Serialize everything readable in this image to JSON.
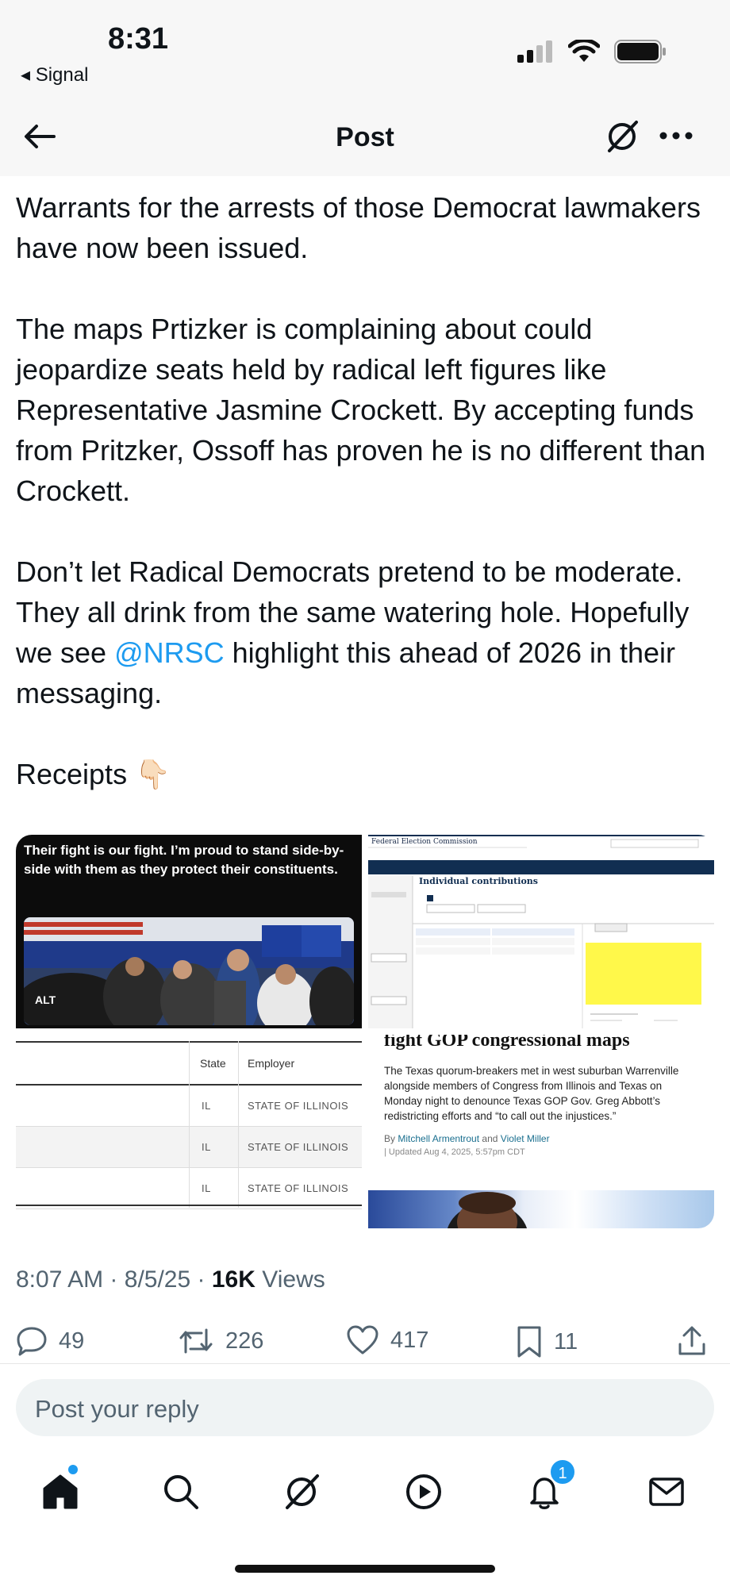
{
  "status_bar": {
    "time": "8:31",
    "back_app": "◂ Signal"
  },
  "header": {
    "title": "Post",
    "icons": {
      "back": "back-arrow-icon",
      "grok": "grok-icon",
      "more": "more-icon"
    }
  },
  "post": {
    "paragraphs": [
      "Warrants for the arrests of those Democrat lawmakers have now been issued.",
      "The maps Prtizker is complaining about could jeopardize seats held by radical left figures like Representative Jasmine Crockett. By accepting funds from Pritzker, Ossoff has proven he is no different than Crockett.",
      "Receipts 👇🏻"
    ],
    "para3_before": "Don’t let Radical Democrats pretend to be moderate. They all drink from the same watering hole. Hopefully we see ",
    "mention": "@NRSC",
    "para3_after": " highlight this ahead of 2026 in their messaging."
  },
  "media": {
    "tile1": {
      "quote": "Their fight is our fight. I’m proud to stand side-by-side with them as they protect their constituents.",
      "badge": "ALT"
    },
    "tile2": {
      "agency": "Federal Election Commission",
      "section": "Individual contributions"
    },
    "tile3": {
      "headers": [
        "State",
        "Employer"
      ],
      "rows": [
        {
          "state": "IL",
          "employer": "STATE OF ILLINOIS"
        },
        {
          "state": "IL",
          "employer": "STATE OF ILLINOIS"
        },
        {
          "state": "IL",
          "employer": "STATE OF ILLINOIS"
        }
      ]
    },
    "tile4": {
      "headline": "fight GOP congressional maps",
      "body": "The Texas quorum-breakers met in west suburban Warrenville alongside members of Congress from Illinois and Texas on Monday night to denounce Texas GOP Gov. Greg Abbott’s redistricting efforts and “to call out the injustices.”",
      "by": "By",
      "author1": "Mitchell Armentrout",
      "and": "and",
      "author2": "Violet Miller",
      "updated": "| Updated Aug 4, 2025, 5:57pm CDT"
    }
  },
  "meta": {
    "time": "8:07 AM",
    "date": "8/5/25",
    "views_count": "16K",
    "views_label": "Views",
    "sep": "·"
  },
  "actions": {
    "replies": "49",
    "reposts": "226",
    "likes": "417",
    "bookmarks": "11"
  },
  "reply": {
    "placeholder": "Post your reply"
  },
  "tabbar": {
    "notification_count": "1"
  },
  "colors": {
    "accent": "#1d9bf0",
    "text": "#0f1419",
    "muted": "#536471"
  }
}
